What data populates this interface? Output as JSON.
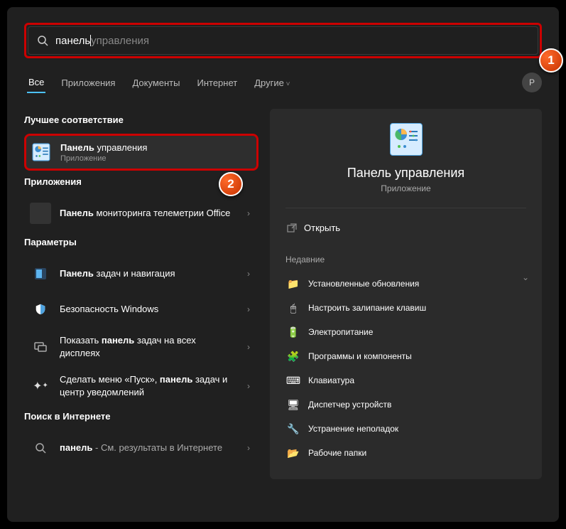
{
  "search": {
    "typed": "панель",
    "suggestion": " управления"
  },
  "tabs": [
    "Все",
    "Приложения",
    "Документы",
    "Интернет",
    "Другие"
  ],
  "avatar_letter": "P",
  "sections": {
    "best": "Лучшее соответствие",
    "apps": "Приложения",
    "settings": "Параметры",
    "web": "Поиск в Интернете"
  },
  "best_match": {
    "title_bold": "Панель",
    "title_rest": " управления",
    "sub": "Приложение"
  },
  "apps": [
    {
      "bold": "Панель",
      "rest": " мониторинга телеметрии Office"
    }
  ],
  "settings": [
    {
      "bold": "Панель",
      "rest": " задач и навигация",
      "icon": "gear"
    },
    {
      "plain": "Безопасность Windows",
      "icon": "shield"
    },
    {
      "pre": "Показать ",
      "bold": "панель",
      "rest": " задач на всех дисплеях",
      "icon": "display"
    },
    {
      "pre": "Сделать меню «Пуск», ",
      "bold": "панель",
      "rest": " задач и центр уведомлений",
      "icon": "star"
    }
  ],
  "web": {
    "bold": "панель",
    "rest": " - См. результаты в Интернете",
    "icon": "search"
  },
  "detail": {
    "title": "Панель управления",
    "sub": "Приложение",
    "open": "Открыть",
    "recent_label": "Недавние",
    "recent": [
      {
        "icon": "📁",
        "label": "Установленные обновления"
      },
      {
        "icon": "🖱",
        "label": "Настроить залипание клавиш"
      },
      {
        "icon": "🔋",
        "label": "Электропитание"
      },
      {
        "icon": "🧩",
        "label": "Программы и компоненты"
      },
      {
        "icon": "⌨",
        "label": "Клавиатура"
      },
      {
        "icon": "🖥",
        "label": "Диспетчер устройств"
      },
      {
        "icon": "🔧",
        "label": "Устранение неполадок"
      },
      {
        "icon": "📂",
        "label": "Рабочие папки"
      }
    ]
  },
  "badges": {
    "b1": "1",
    "b2": "2"
  }
}
